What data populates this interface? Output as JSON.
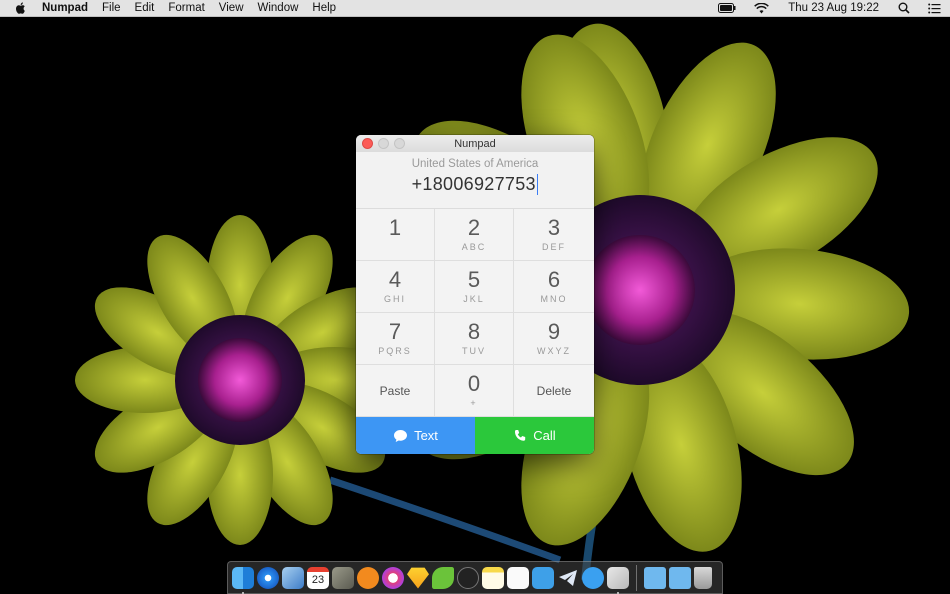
{
  "menubar": {
    "app_name": "Numpad",
    "menus": [
      "File",
      "Edit",
      "Format",
      "View",
      "Window",
      "Help"
    ],
    "clock": "Thu 23 Aug  19:22",
    "status_icons": [
      "battery-icon",
      "wifi-icon",
      "spotlight-search-icon",
      "notification-center-icon"
    ]
  },
  "window": {
    "title": "Numpad",
    "country": "United States of America",
    "number": "+18006927753",
    "keys": [
      {
        "digit": "1",
        "letters": ""
      },
      {
        "digit": "2",
        "letters": "ABC"
      },
      {
        "digit": "3",
        "letters": "DEF"
      },
      {
        "digit": "4",
        "letters": "GHI"
      },
      {
        "digit": "5",
        "letters": "JKL"
      },
      {
        "digit": "6",
        "letters": "MNO"
      },
      {
        "digit": "7",
        "letters": "PQRS"
      },
      {
        "digit": "8",
        "letters": "TUV"
      },
      {
        "digit": "9",
        "letters": "WXYZ"
      }
    ],
    "paste_label": "Paste",
    "zero": {
      "digit": "0",
      "letters": "+"
    },
    "delete_label": "Delete",
    "text_label": "Text",
    "call_label": "Call"
  },
  "dock": {
    "apps": [
      "finder-icon",
      "safari-icon",
      "preview-icon",
      "calendar-icon",
      "keychain-icon",
      "books-icon",
      "itunes-icon",
      "sketch-icon",
      "evernote-icon",
      "bbedit-icon",
      "notes-icon",
      "reminders-icon",
      "tweetbot-icon",
      "telegram-icon",
      "messages-icon",
      "numpad-icon"
    ],
    "calendar_day": "23",
    "folders": [
      "applications-folder-icon",
      "screenshots-folder-icon",
      "trash-icon"
    ]
  },
  "colors": {
    "text_button": "#3d96f4",
    "call_button": "#2bc83b",
    "close_button": "#fc5b57"
  }
}
